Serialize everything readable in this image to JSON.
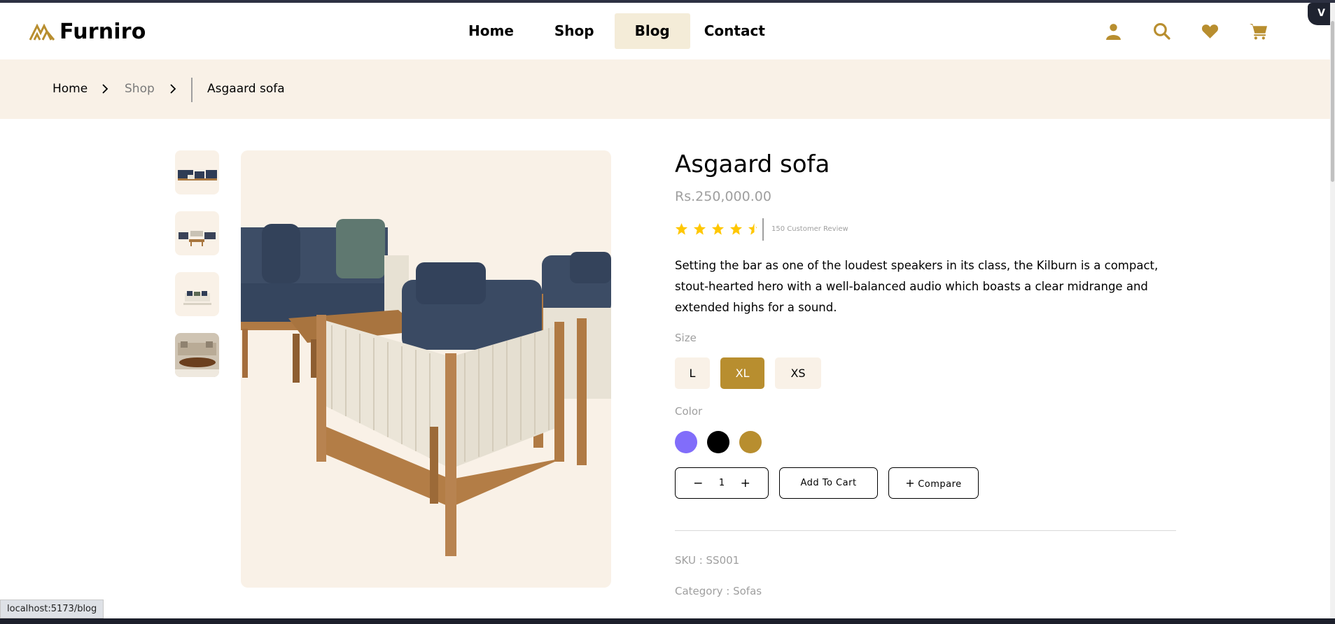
{
  "brand": {
    "name": "Furniro",
    "accent": "#b88e2f",
    "logo_icon": "furniro-logo-icon"
  },
  "nav": {
    "items": [
      {
        "label": "Home",
        "active": false
      },
      {
        "label": "Shop",
        "active": false
      },
      {
        "label": "Blog",
        "active": true
      },
      {
        "label": "Contact",
        "active": false
      }
    ]
  },
  "header_icons": [
    "user-icon",
    "search-icon",
    "heart-icon",
    "cart-icon"
  ],
  "breadcrumb": {
    "home": "Home",
    "shop": "Shop",
    "current": "Asgaard sofa"
  },
  "product": {
    "title": "Asgaard sofa",
    "price": "Rs.250,000.00",
    "rating": 4.5,
    "review_text": "150 Customer Review",
    "description": "Setting the bar as one of the loudest speakers in its class, the Kilburn is a compact, stout-hearted hero with a well-balanced audio which boasts a clear midrange and extended highs for a sound.",
    "size_label": "Size",
    "sizes": [
      {
        "label": "L",
        "selected": false
      },
      {
        "label": "XL",
        "selected": true
      },
      {
        "label": "XS",
        "selected": false
      }
    ],
    "color_label": "Color",
    "colors": [
      "#816dfa",
      "#000000",
      "#b88e2f"
    ],
    "quantity": "1",
    "qty_minus": "−",
    "qty_plus": "+",
    "add_to_cart": "Add To Cart",
    "compare_plus": "+",
    "compare": "Compare",
    "sku": "SKU : SS001",
    "category": "Category : Sofas"
  },
  "status_bar_url": "localhost:5173/blog",
  "dev_badge": "V"
}
